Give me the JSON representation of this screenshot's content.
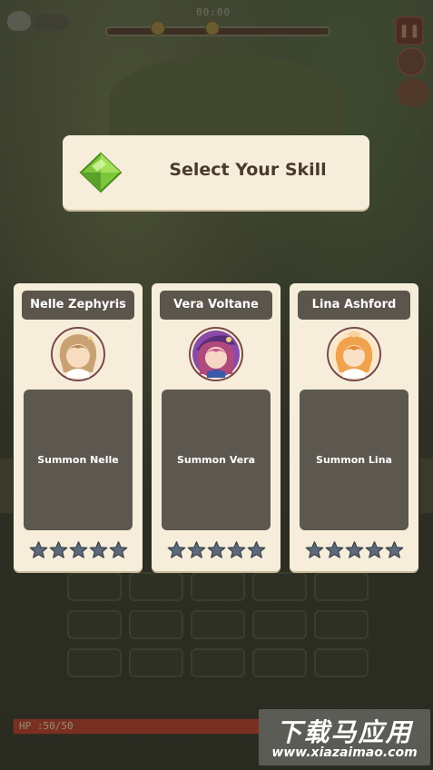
{
  "hud": {
    "timer": "00:00",
    "wave_progress": 0.0,
    "hp_label": "HP :50/50",
    "hp_fraction": 1.0,
    "pause_icon": "pause-icon",
    "colors": {
      "hp_bar": "#7a3020"
    }
  },
  "dialog": {
    "title": "Select Your Skill",
    "icon": "green-gem-icon",
    "colors": {
      "panel": "#f6eedb",
      "title": "#4b3a2c"
    }
  },
  "cards": [
    {
      "name": "Nelle Zephyris",
      "summon_label": "Summon Nelle",
      "avatar": "nelle-avatar-icon",
      "stars": 5,
      "stars_filled": 0,
      "hair_color": "#c9a274",
      "accent": "#f3d8a6"
    },
    {
      "name": "Vera Voltane",
      "summon_label": "Summon Vera",
      "avatar": "vera-avatar-icon",
      "stars": 5,
      "stars_filled": 0,
      "hair_color": "#b0497c",
      "accent": "#7a3e9a"
    },
    {
      "name": "Lina Ashford",
      "summon_label": "Summon Lina",
      "avatar": "lina-avatar-icon",
      "stars": 5,
      "stars_filled": 0,
      "hair_color": "#f0a24c",
      "accent": "#f7d29a"
    }
  ],
  "colors": {
    "name_plate": "#5b554b",
    "summon_box": "#5c5850",
    "star_empty": "#5d6a7a"
  },
  "watermark": {
    "text": "下载马应用",
    "url": "www.xiazaimao.com"
  }
}
